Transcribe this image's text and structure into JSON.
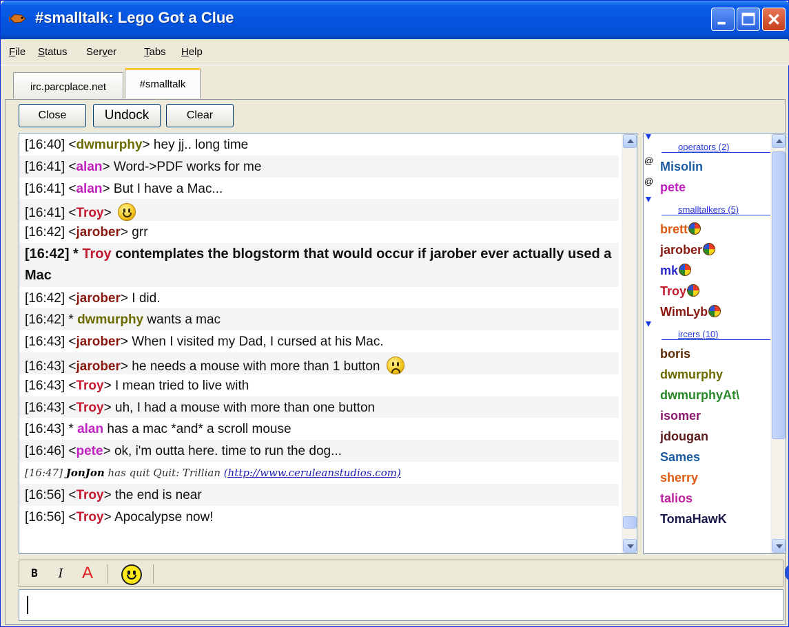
{
  "window": {
    "title": "#smalltalk: Lego Got a Clue"
  },
  "menu": [
    {
      "accel": "F",
      "rest": "ile"
    },
    {
      "accel": "S",
      "rest": "tatus"
    },
    {
      "pre": "Ser",
      "accel": "v",
      "rest": "er"
    },
    {
      "accel": "T",
      "rest": "abs"
    },
    {
      "accel": "H",
      "rest": "elp"
    }
  ],
  "tabs": [
    {
      "label": "irc.parcplace.net",
      "active": false
    },
    {
      "label": "#smalltalk",
      "active": true
    }
  ],
  "buttons": {
    "close": "Close",
    "undock": "Undock",
    "clear": "Clear"
  },
  "colors": {
    "dwmurphy": "#6b6b00",
    "alan": "#c020c0",
    "troy": "#c41a30",
    "jarober": "#8a1a10",
    "pete": "#c020c0",
    "jonjon": "#000000"
  },
  "chat": [
    {
      "time": "[16:40]",
      "nick": "dwmurphy",
      "color": "#6b6b00",
      "text": " hey jj.. long time"
    },
    {
      "time": "[16:41]",
      "nick": "alan",
      "color": "#c020c0",
      "text": " Word->PDF works for me"
    },
    {
      "time": "[16:41]",
      "nick": "alan",
      "color": "#c020c0",
      "text": " But I have a Mac..."
    },
    {
      "time": "[16:41]",
      "nick": "Troy",
      "color": "#c41a30",
      "text": "",
      "smiley": "happy"
    },
    {
      "time": "[16:42]",
      "nick": "jarober",
      "color": "#8a1a10",
      "text": " grr"
    },
    {
      "time": "[16:42]",
      "type": "action-bold",
      "nick": "Troy",
      "color": "#c41a30",
      "text": " contemplates the blogstorm that would occur if jarober ever actually used a Mac"
    },
    {
      "time": "[16:42]",
      "nick": "jarober",
      "color": "#8a1a10",
      "text": " I did."
    },
    {
      "time": "[16:42]",
      "type": "action",
      "nick": "dwmurphy",
      "color": "#6b6b00",
      "text": " wants a mac"
    },
    {
      "time": "[16:43]",
      "nick": "jarober",
      "color": "#8a1a10",
      "text": " When I visited my Dad, I cursed at his Mac."
    },
    {
      "time": "[16:43]",
      "nick": "jarober",
      "color": "#8a1a10",
      "text": " he needs a mouse with more than 1 button",
      "smiley": "sad"
    },
    {
      "time": "[16:43]",
      "nick": "Troy",
      "color": "#c41a30",
      "text": " I mean tried to live with"
    },
    {
      "time": "[16:43]",
      "nick": "Troy",
      "color": "#c41a30",
      "text": " uh, I had a mouse with more than one button"
    },
    {
      "time": "[16:43]",
      "type": "action",
      "nick": "alan",
      "color": "#c020c0",
      "text": " has a mac *and* a scroll mouse"
    },
    {
      "time": "[16:46]",
      "nick": "pete",
      "color": "#c020c0",
      "text": " ok, i'm outta here.  time to run the dog..."
    },
    {
      "time": "[16:47]",
      "type": "quit",
      "nick": "JonJon",
      "text": " has quit Quit: Trillian ",
      "link": "(http://www.ceruleanstudios.com)"
    },
    {
      "time": "[16:56]",
      "nick": "Troy",
      "color": "#c41a30",
      "text": " the end is near"
    },
    {
      "time": "[16:56]",
      "nick": "Troy",
      "color": "#c41a30",
      "text": " Apocalypse now!"
    }
  ],
  "nicklist": [
    {
      "group": "operators (2)"
    },
    {
      "nick": "Misolin",
      "color": "#1a5aa0",
      "op": "@"
    },
    {
      "nick": "pete",
      "color": "#c020c0",
      "op": "@"
    },
    {
      "group": "smalltalkers (5)"
    },
    {
      "nick": "brett",
      "color": "#e05a10",
      "gem": true
    },
    {
      "nick": "jarober",
      "color": "#8a1a10",
      "gem": true
    },
    {
      "nick": "mk",
      "color": "#2a2ad0",
      "gem": true
    },
    {
      "nick": "Troy",
      "color": "#c41a30",
      "gem": true
    },
    {
      "nick": "WimLyb",
      "color": "#8a1a10",
      "gem": true
    },
    {
      "group": "ircers (10)"
    },
    {
      "nick": "boris",
      "color": "#5a2a00"
    },
    {
      "nick": "dwmurphy",
      "color": "#6b6b00"
    },
    {
      "nick": "dwmurphyAt\\",
      "color": "#2a8a2a"
    },
    {
      "nick": "isomer",
      "color": "#8a1a6a"
    },
    {
      "nick": "jdougan",
      "color": "#5a1a1a"
    },
    {
      "nick": "Sames",
      "color": "#1a5aa0"
    },
    {
      "nick": "sherry",
      "color": "#e05a10"
    },
    {
      "nick": "talios",
      "color": "#c020a0"
    },
    {
      "nick": "TomaHawK",
      "color": "#1a1a4a"
    }
  ],
  "format_toolbar": {
    "bold": "B",
    "italic": "I",
    "color": "A"
  },
  "input": {
    "value": ""
  }
}
